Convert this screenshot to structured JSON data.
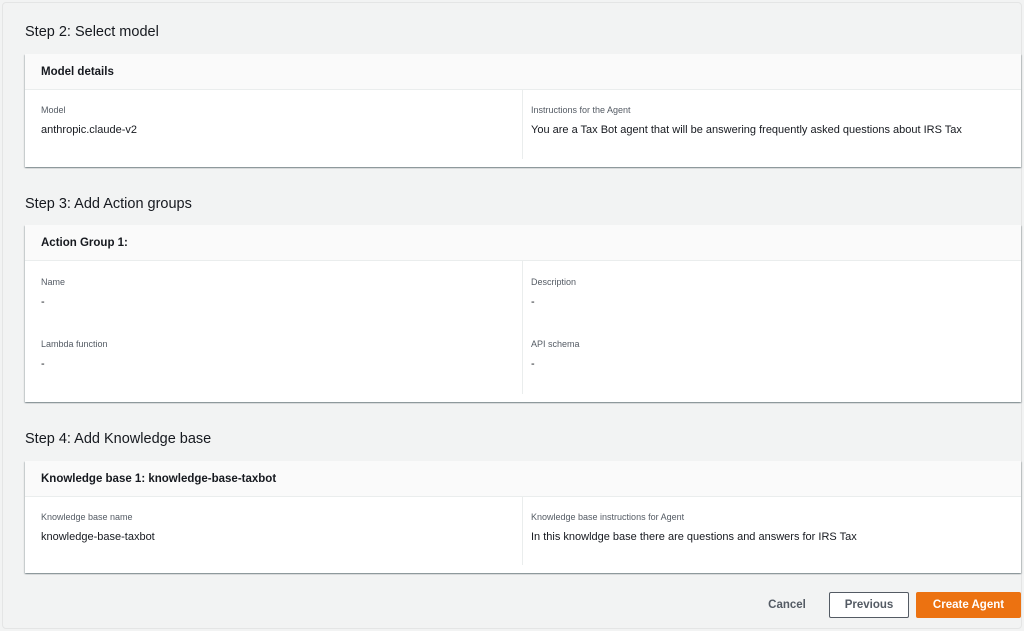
{
  "step2": {
    "title": "Step 2: Select model",
    "header": "Model details",
    "model_label": "Model",
    "model_value": "anthropic.claude-v2",
    "instructions_label": "Instructions for the Agent",
    "instructions_value": "You are a Tax Bot agent that will be answering frequently asked questions about IRS Tax"
  },
  "step3": {
    "title": "Step 3: Add Action groups",
    "header": "Action Group 1:",
    "name_label": "Name",
    "name_value": "-",
    "description_label": "Description",
    "description_value": "-",
    "lambda_label": "Lambda function",
    "lambda_value": "-",
    "api_label": "API schema",
    "api_value": "-"
  },
  "step4": {
    "title": "Step 4: Add Knowledge base",
    "header": "Knowledge base 1: knowledge-base-taxbot",
    "kb_name_label": "Knowledge base name",
    "kb_name_value": "knowledge-base-taxbot",
    "kb_instructions_label": "Knowledge base instructions for Agent",
    "kb_instructions_value": "In this knowldge base there are questions and answers for IRS Tax"
  },
  "footer": {
    "cancel_label": "Cancel",
    "previous_label": "Previous",
    "create_label": "Create Agent"
  },
  "colors": {
    "primary_button": "#ec7211",
    "background": "#f2f3f3",
    "panel_header": "#fafafa"
  }
}
